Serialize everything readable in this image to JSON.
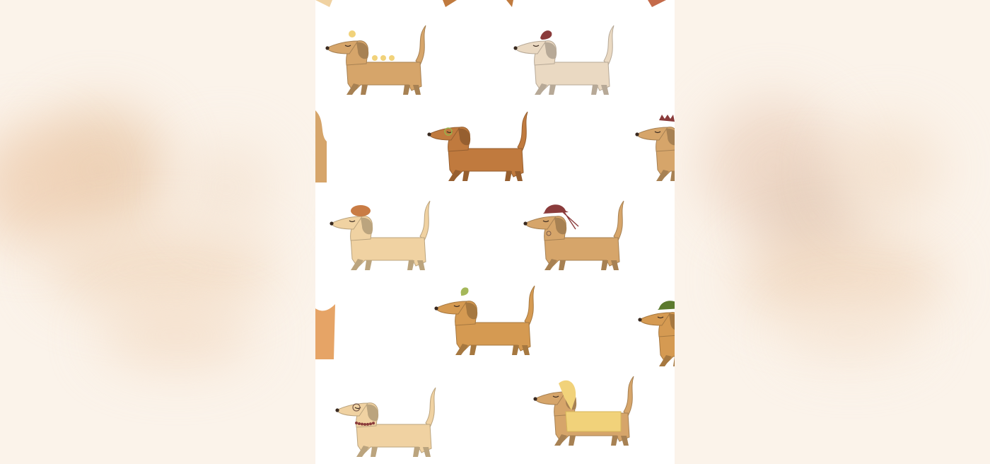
{
  "image": {
    "subject": "dachshund-pattern",
    "colors": {
      "panel_background": "#ffffff",
      "blur_background": "#fbf3ea",
      "dog_tan": "#d6a56a",
      "dog_light": "#f0d2a2",
      "dog_cream": "#ead9c2",
      "dog_brown": "#c07a3e",
      "dog_golden": "#d59a52",
      "accent_maroon": "#8a3b3b",
      "accent_green": "#5c7a2e",
      "accent_yellow": "#f1d27a"
    },
    "dogs": [
      {
        "id": "dog-ducklings",
        "coat": "tan",
        "accessory": "birds"
      },
      {
        "id": "dog-cream-bird",
        "coat": "cream",
        "accessory": "bird-hat"
      },
      {
        "id": "dog-glasses-brown",
        "coat": "brown",
        "accessory": "glasses"
      },
      {
        "id": "dog-crown-partial",
        "coat": "tan",
        "accessory": "crown"
      },
      {
        "id": "dog-beret",
        "coat": "light",
        "accessory": "beret"
      },
      {
        "id": "dog-maroon-hat",
        "coat": "tan",
        "accessory": "hat"
      },
      {
        "id": "dog-green-bird",
        "coat": "golden",
        "accessory": "bird"
      },
      {
        "id": "dog-green-hat-partial",
        "coat": "golden",
        "accessory": "hat"
      },
      {
        "id": "dog-necklace",
        "coat": "light",
        "accessory": "necklace"
      },
      {
        "id": "dog-blonde-coat",
        "coat": "tan",
        "accessory": "coat"
      }
    ]
  }
}
